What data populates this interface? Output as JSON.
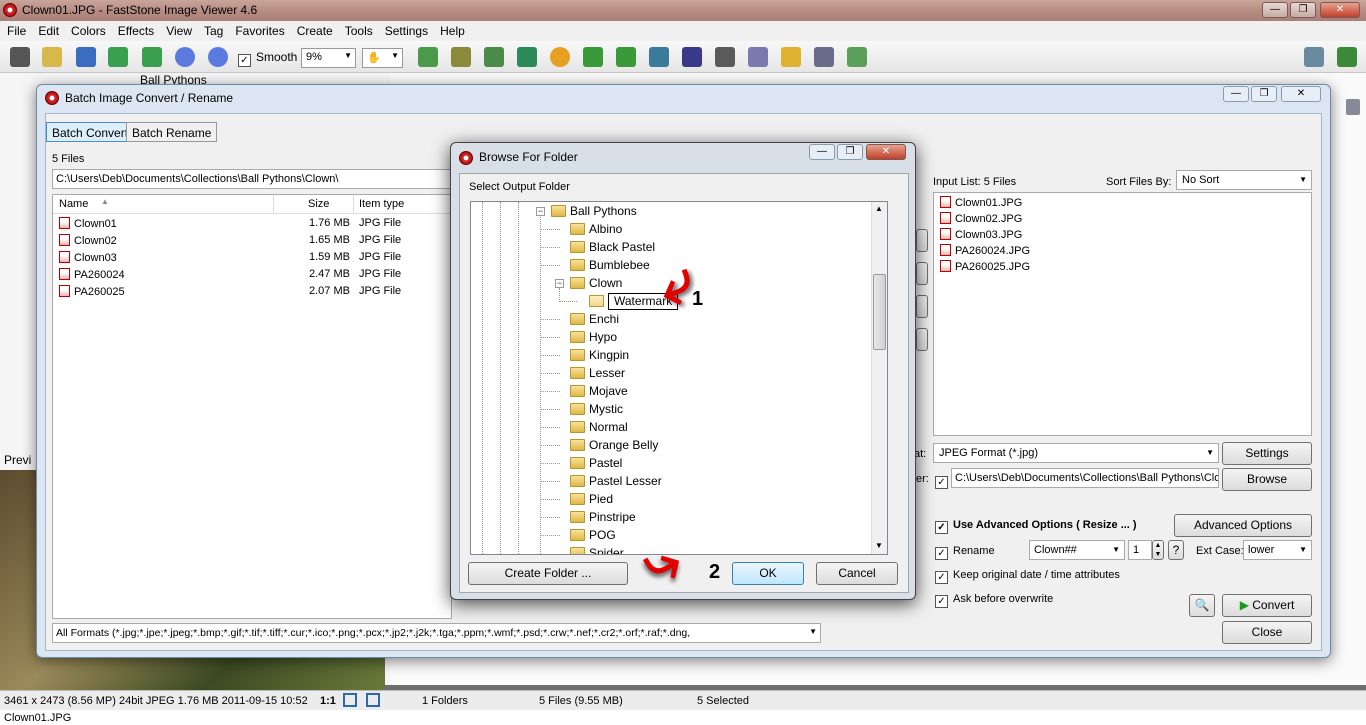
{
  "app": {
    "title": "Clown01.JPG  -  FastStone Image Viewer 4.6",
    "menu": [
      "File",
      "Edit",
      "Colors",
      "Effects",
      "View",
      "Tag",
      "Favorites",
      "Create",
      "Tools",
      "Settings",
      "Help"
    ],
    "smooth_label": "Smooth",
    "zoom_value": "9%",
    "tree_peek": "Ball Pythons",
    "preview_label": "Previ",
    "status": {
      "image_info": "3461 x 2473 (8.56 MP)  24bit  JPEG  1.76 MB  2011-09-15 10:52",
      "ratio": "1:1",
      "folders": "1 Folders",
      "files": "5 Files (9.55 MB)",
      "selected": "5 Selected"
    },
    "bottom_filename": "Clown01.JPG"
  },
  "batch": {
    "title": "Batch Image Convert / Rename",
    "tabs": [
      "Batch Convert",
      "Batch Rename"
    ],
    "file_count": "5 Files",
    "path": "C:\\Users\\Deb\\Documents\\Collections\\Ball Pythons\\Clown\\",
    "columns": {
      "name": "Name",
      "size": "Size",
      "type": "Item type"
    },
    "files": [
      {
        "name": "Clown01",
        "size": "1.76 MB",
        "type": "JPG File"
      },
      {
        "name": "Clown02",
        "size": "1.65 MB",
        "type": "JPG File"
      },
      {
        "name": "Clown03",
        "size": "1.59 MB",
        "type": "JPG File"
      },
      {
        "name": "PA260024",
        "size": "2.47 MB",
        "type": "JPG File"
      },
      {
        "name": "PA260025",
        "size": "2.07 MB",
        "type": "JPG File"
      }
    ],
    "format_filter": "All Formats (*.jpg;*.jpe;*.jpeg;*.bmp;*.gif;*.tif;*.tiff;*.cur;*.ico;*.png;*.pcx;*.jp2;*.j2k;*.tga;*.ppm;*.wmf;*.psd;*.crw;*.nef;*.cr2;*.orf;*.raf;*.dng,",
    "input_list_label": "Input List:  5 Files",
    "sort_label": "Sort Files By:",
    "sort_value": "No Sort",
    "input_files": [
      "Clown01.JPG",
      "Clown02.JPG",
      "Clown03.JPG",
      "PA260024.JPG",
      "PA260025.JPG"
    ],
    "format_label_tail": "at:",
    "output_format": "JPEG Format (*.jpg)",
    "settings_btn": "Settings",
    "folder_label_tail": "er:",
    "output_folder": "C:\\Users\\Deb\\Documents\\Collections\\Ball Pythons\\Clow",
    "browse_btn": "Browse",
    "use_advanced": "Use Advanced Options ( Resize ... )",
    "advanced_btn": "Advanced Options",
    "rename_label": "Rename",
    "rename_pattern": "Clown##",
    "rename_start": "1",
    "help_btn": "?",
    "ext_case_label": "Ext Case:",
    "ext_case_value": "lower",
    "keep_date": "Keep original date / time attributes",
    "ask_overwrite": "Ask before overwrite",
    "convert_btn": "Convert",
    "close_btn": "Close"
  },
  "browse": {
    "title": "Browse For Folder",
    "prompt": "Select Output Folder",
    "parent": "Ball Pythons",
    "folders": [
      "Albino",
      "Black Pastel",
      "Bumblebee",
      "Clown"
    ],
    "editing": "Watermark",
    "folders_after": [
      "Enchi",
      "Hypo",
      "Kingpin",
      "Lesser",
      "Mojave",
      "Mystic",
      "Normal",
      "Orange Belly",
      "Pastel",
      "Pastel Lesser",
      "Pied",
      "Pinstripe",
      "POG",
      "Spider"
    ],
    "create_btn": "Create Folder ...",
    "ok_btn": "OK",
    "cancel_btn": "Cancel",
    "annotation1": "1",
    "annotation2": "2"
  }
}
